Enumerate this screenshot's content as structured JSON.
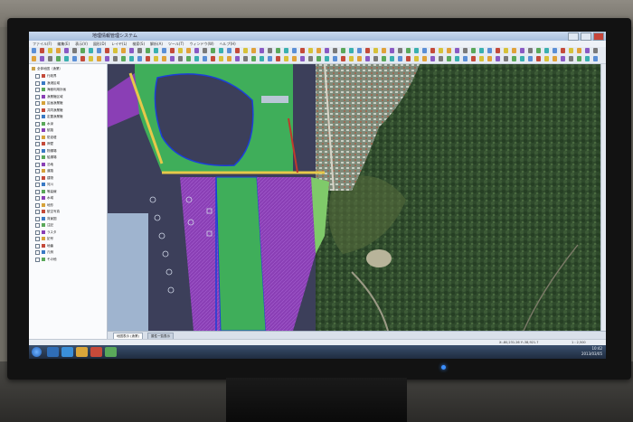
{
  "window": {
    "title": "地理情報管理システム"
  },
  "menu": {
    "items": [
      "ファイル(F)",
      "編集(E)",
      "表示(V)",
      "図形(D)",
      "レイヤ(L)",
      "検索(S)",
      "解析(A)",
      "ツール(T)",
      "ウィンドウ(W)",
      "ヘルプ(H)"
    ]
  },
  "layer_panel": {
    "root_label": "全体地図（漁業）",
    "items": [
      "行政界",
      "漁港区域",
      "海面利用計画",
      "漁業権区域",
      "区画漁業権",
      "共同漁業権",
      "定置漁業権",
      "水深",
      "航路",
      "防波堤",
      "岸壁",
      "物揚場",
      "船揚場",
      "泊地",
      "道路",
      "建物",
      "河川",
      "等高線",
      "水域",
      "地形",
      "航空写真",
      "背景図",
      "注記",
      "ラスタ",
      "記号",
      "地番",
      "凡例",
      "その他"
    ]
  },
  "map": {
    "bottom_tabs": [
      "地図表示 (漁業)",
      "属性一覧表示"
    ]
  },
  "statusbar": {
    "left": "",
    "coords": "X:-80,231.26 Y:-38,921.7",
    "scale": "1 : 2,500"
  },
  "taskbar": {
    "time": "10:42",
    "date": "2013/03/05"
  },
  "colors": {
    "water_dark": "#3c3f5a",
    "zone_purple": "#8a3fb5",
    "zone_green": "#3fae5a",
    "zone_lightgreen": "#7fca6a",
    "boundary_blue": "#1b3fd8",
    "forest": "#2f4a2c"
  }
}
